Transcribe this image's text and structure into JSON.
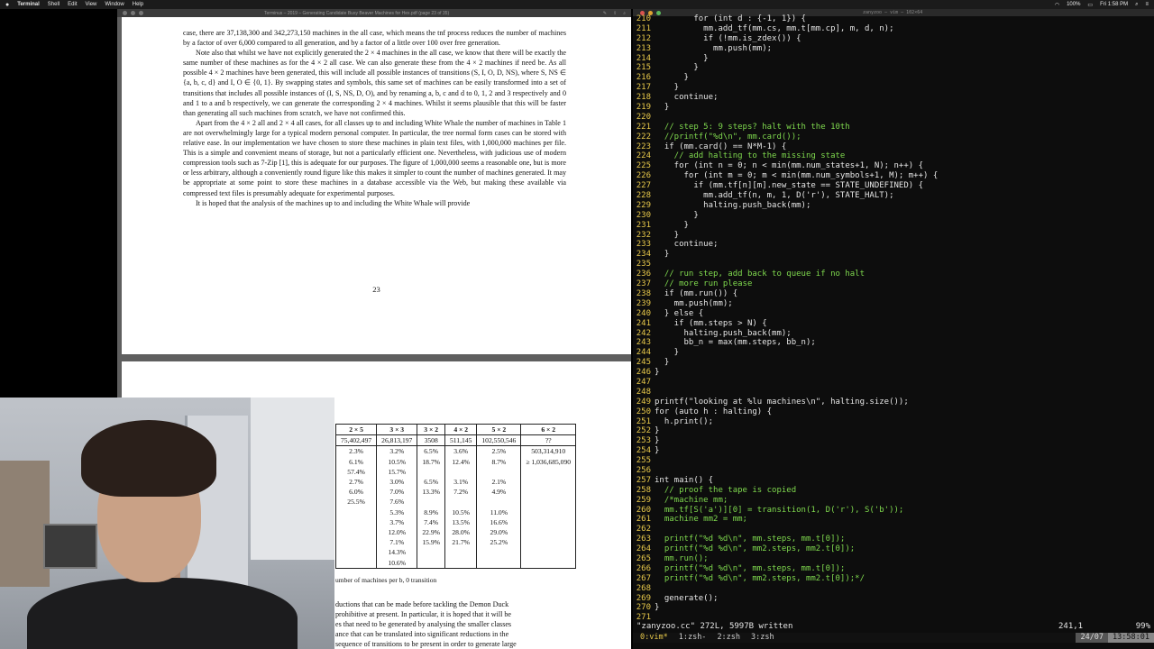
{
  "menubar": {
    "apple": "",
    "app": "Terminal",
    "items": [
      "Shell",
      "Edit",
      "View",
      "Window",
      "Help"
    ],
    "clock": "Fri 1:58 PM",
    "battery": "100%"
  },
  "pdf": {
    "title": "Terminus – 2019 – Generating Candidate Busy Beaver Machines for Hex.pdf (page 23 of 35)",
    "paragraphs": [
      "case, there are 37,138,300 and 342,273,150 machines in the all case, which means the tnf process reduces the number of machines by a factor of over 6,000 compared to all generation, and by a factor of a little over 100 over free generation.",
      "Note also that whilst we have not explicitly generated the 2 × 4 machines in the all case, we know that there will be exactly the same number of these machines as for the 4 × 2 all case. We can also generate these from the 4 × 2 machines if need be. As all possible 4 × 2 machines have been generated, this will include all possible instances of transitions (S, I, O, D, NS), where S, NS ∈ {a, b, c, d} and I, O ∈ {0, 1}. By swapping states and symbols, this same set of machines can be easily transformed into a set of transitions that includes all possible instances of (I, S, NS, D, O), and by renaming a, b, c and d to 0, 1, 2 and 3 respectively and 0 and 1 to a and b respectively, we can generate the corresponding 2 × 4 machines. Whilst it seems plausible that this will be faster than generating all such machines from scratch, we have not confirmed this.",
      "Apart from the 4 × 2 all and 2 × 4 all cases, for all classes up to and including White Whale the number of machines in Table 1 are not overwhelmingly large for a typical modern personal computer. In particular, the tree normal form cases can be stored with relative ease. In our implementation we have chosen to store these machines in plain text files, with 1,000,000 machines per file. This is a simple and convenient means of storage, but not a particularly efficient one. Nevertheless, with judicious use of modern compression tools such as 7-Zip [1], this is adequate for our purposes. The figure of 1,000,000 seems a reasonable one, but is more or less arbitrary, although a conveniently round figure like this makes it simpler to count the number of machines generated. It may be appropriate at some point to store these machines in a database accessible via the Web, but making these available via compressed text files is presumably adequate for experimental purposes.",
      "It is hoped that the analysis of the machines up to and including the White Whale will provide"
    ],
    "page_number": "23",
    "cursor_glyph": "⌃",
    "table": {
      "headers": [
        "2 × 5",
        "3 × 3",
        "3 × 2",
        "4 × 2",
        "5 × 2",
        "6 × 2"
      ],
      "totals": [
        "75,402,497",
        "26,813,197",
        "3508",
        "511,145",
        "102,550,546",
        "??"
      ],
      "rows": [
        [
          "2.3%",
          "3.2%",
          "6.5%",
          "3.6%",
          "2.5%",
          "503,314,910"
        ],
        [
          "6.1%",
          "10.5%",
          "18.7%",
          "12.4%",
          "8.7%",
          "≥ 1,036,685,090"
        ],
        [
          "57.4%",
          "15.7%",
          "",
          "",
          "",
          ""
        ],
        [
          "2.7%",
          "3.0%",
          "6.5%",
          "3.1%",
          "2.1%",
          ""
        ],
        [
          "6.0%",
          "7.0%",
          "13.3%",
          "7.2%",
          "4.9%",
          ""
        ],
        [
          "25.5%",
          "7.6%",
          "",
          "",
          "",
          ""
        ],
        [
          "",
          "5.3%",
          "8.9%",
          "10.5%",
          "11.0%",
          ""
        ],
        [
          "",
          "3.7%",
          "7.4%",
          "13.5%",
          "16.6%",
          ""
        ],
        [
          "",
          "12.0%",
          "22.9%",
          "28.0%",
          "29.0%",
          ""
        ],
        [
          "",
          "7.1%",
          "15.9%",
          "21.7%",
          "25.2%",
          ""
        ],
        [
          "",
          "14.3%",
          "",
          "",
          "",
          ""
        ],
        [
          "",
          "10.6%",
          "",
          "",
          "",
          ""
        ]
      ]
    },
    "caption": "umber of machines per b, 0 transition",
    "page2_lines": [
      "ductions that can be made before tackling the Demon Duck",
      "prohibitive at present. In particular, it is hoped that it will be",
      "es that need to be generated by analysing the smaller classes",
      "ance that can be translated into significant reductions in the",
      "sequence of transitions to be present in order to generate large"
    ]
  },
  "terminal": {
    "title": "zanyzoo — vim — 102×64",
    "lines": [
      {
        "n": "210",
        "t": "        for (int d : {-1, 1}) {",
        "c": false
      },
      {
        "n": "211",
        "t": "          mm.add_tf(mm.cs, mm.t[mm.cp], m, d, n);",
        "c": false
      },
      {
        "n": "212",
        "t": "          if (!mm.is_zdex()) {",
        "c": false
      },
      {
        "n": "213",
        "t": "            mm.push(mm);",
        "c": false
      },
      {
        "n": "214",
        "t": "          }",
        "c": false
      },
      {
        "n": "215",
        "t": "        }",
        "c": false
      },
      {
        "n": "216",
        "t": "      }",
        "c": false
      },
      {
        "n": "217",
        "t": "    }",
        "c": false
      },
      {
        "n": "218",
        "t": "    continue;",
        "c": false
      },
      {
        "n": "219",
        "t": "  }",
        "c": false
      },
      {
        "n": "220",
        "t": "",
        "c": false
      },
      {
        "n": "221",
        "t": "  // step 5: 9 steps? halt with the 10th",
        "c": true
      },
      {
        "n": "222",
        "t": "  //printf(\"%d\\n\", mm.card());",
        "c": true
      },
      {
        "n": "223",
        "t": "  if (mm.card() == N*M-1) {",
        "c": false
      },
      {
        "n": "224",
        "t": "    // add halting to the missing state",
        "c": true
      },
      {
        "n": "225",
        "t": "    for (int n = 0; n < min(mm.num_states+1, N); n++) {",
        "c": false
      },
      {
        "n": "226",
        "t": "      for (int m = 0; m < min(mm.num_symbols+1, M); m++) {",
        "c": false
      },
      {
        "n": "227",
        "t": "        if (mm.tf[n][m].new_state == STATE_UNDEFINED) {",
        "c": false
      },
      {
        "n": "228",
        "t": "          mm.add_tf(n, m, 1, D('r'), STATE_HALT);",
        "c": false
      },
      {
        "n": "229",
        "t": "          halting.push_back(mm);",
        "c": false
      },
      {
        "n": "230",
        "t": "        }",
        "c": false
      },
      {
        "n": "231",
        "t": "      }",
        "c": false
      },
      {
        "n": "232",
        "t": "    }",
        "c": false
      },
      {
        "n": "233",
        "t": "    continue;",
        "c": false
      },
      {
        "n": "234",
        "t": "  }",
        "c": false
      },
      {
        "n": "235",
        "t": "",
        "c": false
      },
      {
        "n": "236",
        "t": "  // run step, add back to queue if no halt",
        "c": true
      },
      {
        "n": "237",
        "t": "  // more run please",
        "c": true
      },
      {
        "n": "238",
        "t": "  if (mm.run()) {",
        "c": false
      },
      {
        "n": "239",
        "t": "    mm.push(mm);",
        "c": false
      },
      {
        "n": "240",
        "t": "  } else {",
        "c": false
      },
      {
        "n": "241",
        "t": "    if (mm.steps > N) {",
        "c": false
      },
      {
        "n": "242",
        "t": "      halting.push_back(mm);",
        "c": false
      },
      {
        "n": "243",
        "t": "      bb_n = max(mm.steps, bb_n);",
        "c": false
      },
      {
        "n": "244",
        "t": "    }",
        "c": false
      },
      {
        "n": "245",
        "t": "  }",
        "c": false
      },
      {
        "n": "246",
        "t": "}",
        "c": false
      },
      {
        "n": "247",
        "t": "",
        "c": false
      },
      {
        "n": "248",
        "t": "",
        "c": false
      },
      {
        "n": "249",
        "t": "printf(\"looking at %lu machines\\n\", halting.size());",
        "c": false
      },
      {
        "n": "250",
        "t": "for (auto h : halting) {",
        "c": false
      },
      {
        "n": "251",
        "t": "  h.print();",
        "c": false
      },
      {
        "n": "252",
        "t": "}",
        "c": false
      },
      {
        "n": "253",
        "t": "}",
        "c": false
      },
      {
        "n": "254",
        "t": "}",
        "c": false
      },
      {
        "n": "255",
        "t": "",
        "c": false
      },
      {
        "n": "256",
        "t": "",
        "c": false
      },
      {
        "n": "257",
        "t": "int main() {",
        "c": false
      },
      {
        "n": "258",
        "t": "  // proof the tape is copied",
        "c": true
      },
      {
        "n": "259",
        "t": "  /*machine mm;",
        "c": true
      },
      {
        "n": "260",
        "t": "  mm.tf[S('a')][0] = transition(1, D('r'), S('b'));",
        "c": true
      },
      {
        "n": "261",
        "t": "  machine mm2 = mm;",
        "c": true
      },
      {
        "n": "262",
        "t": "",
        "c": false
      },
      {
        "n": "263",
        "t": "  printf(\"%d %d\\n\", mm.steps, mm.t[0]);",
        "c": true
      },
      {
        "n": "264",
        "t": "  printf(\"%d %d\\n\", mm2.steps, mm2.t[0]);",
        "c": true
      },
      {
        "n": "265",
        "t": "  mm.run();",
        "c": true
      },
      {
        "n": "266",
        "t": "  printf(\"%d %d\\n\", mm.steps, mm.t[0]);",
        "c": true
      },
      {
        "n": "267",
        "t": "  printf(\"%d %d\\n\", mm2.steps, mm2.t[0]);*/",
        "c": true
      },
      {
        "n": "268",
        "t": "",
        "c": false
      },
      {
        "n": "269",
        "t": "  generate();",
        "c": false
      },
      {
        "n": "270",
        "t": "}",
        "c": false
      },
      {
        "n": "271",
        "t": "",
        "c": false
      }
    ],
    "status_message": "\"zanyzoo.cc\" 272L, 5997B written",
    "cursor_pos": "241,1",
    "scroll_pct": "99%",
    "tmux_windows": [
      "0:vim*",
      "1:zsh-",
      "2:zsh",
      "3:zsh"
    ],
    "date": "24/07",
    "time": "13:58:01"
  },
  "colors": {
    "line_numbers": "#e8c94a",
    "comment": "#7fd94e",
    "code": "#e6e6e6"
  }
}
